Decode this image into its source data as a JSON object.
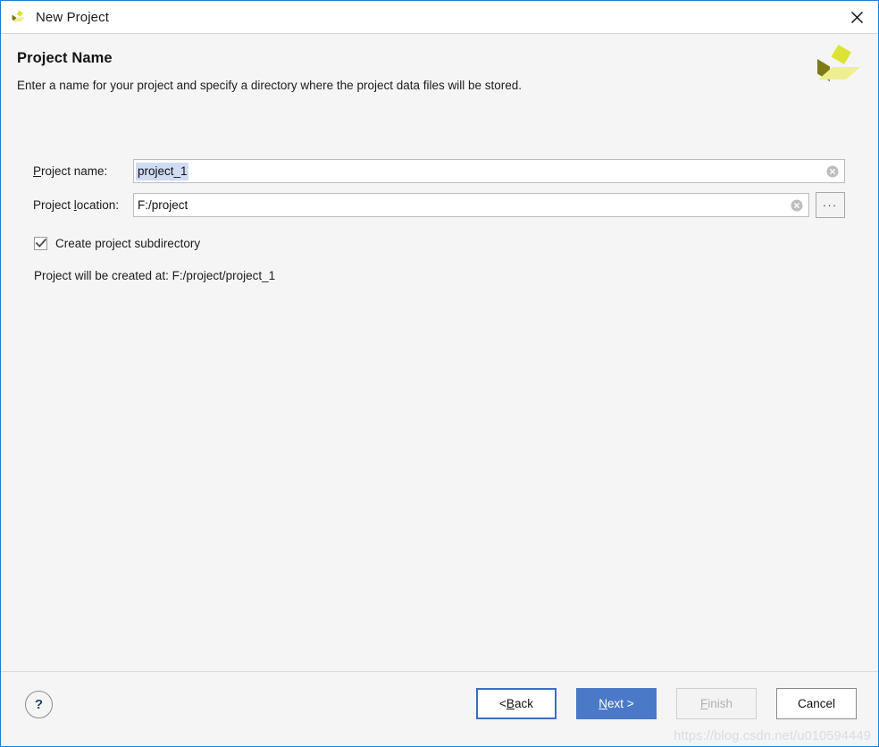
{
  "window": {
    "title": "New Project",
    "app_icon": "vivado-logo-icon",
    "close_icon": "close-icon",
    "border_color": "#1a7fd4",
    "body_color": "#f5f5f5"
  },
  "header": {
    "title": "Project Name",
    "subtitle": "Enter a name for your project and specify a directory where the project data files will be stored.",
    "logo_icon": "vivado-logo-icon",
    "logo_colors": {
      "top": "#dde334",
      "left": "#7d7c16",
      "right": "#eef08f"
    }
  },
  "form": {
    "project_name": {
      "label_prefix": "",
      "label_mnemonic": "P",
      "label_suffix": "roject name:",
      "label_full": "Project name:",
      "value": "project_1",
      "selected": true,
      "selection_color": "#cfdcf4",
      "clear_icon": "clear-circle-icon"
    },
    "project_location": {
      "label_prefix": "Project ",
      "label_mnemonic": "l",
      "label_suffix": "ocation:",
      "label_full": "Project location:",
      "value": "F:/project",
      "selected": false,
      "clear_icon": "clear-circle-icon",
      "browse_label": "...",
      "browse_icon": "ellipsis-icon"
    },
    "create_subdirectory": {
      "label": "Create project subdirectory",
      "checked": true,
      "check_icon": "checkmark-icon"
    },
    "created_at_text": "Project will be created at: F:/project/project_1"
  },
  "footer": {
    "help_label": "?",
    "help_icon": "question-mark-icon",
    "buttons": [
      {
        "name": "back",
        "prefix": "< ",
        "mnemonic": "B",
        "suffix": "ack",
        "label_full": "< Back",
        "state": "focused",
        "accent": "#3a6fc4"
      },
      {
        "name": "next",
        "prefix": "",
        "mnemonic": "N",
        "suffix": "ext >",
        "label_full": "Next >",
        "state": "default",
        "accent": "#4a7ac7"
      },
      {
        "name": "finish",
        "prefix": "",
        "mnemonic": "F",
        "suffix": "inish",
        "label_full": "Finish",
        "state": "disabled",
        "accent": "#b0b0b0"
      },
      {
        "name": "cancel",
        "prefix": "",
        "mnemonic": "",
        "suffix": "Cancel",
        "label_full": "Cancel",
        "state": "normal",
        "accent": "#8a8a8a"
      }
    ]
  },
  "watermark": {
    "text": "https://blog.csdn.net/u010594449"
  }
}
